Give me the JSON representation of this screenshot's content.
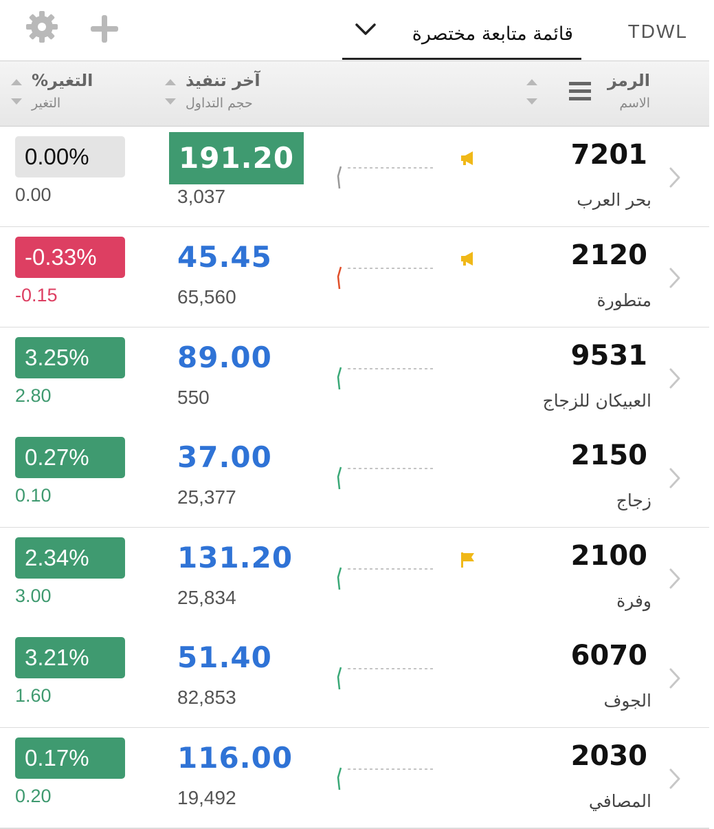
{
  "topbar": {
    "settings_icon": "gear-icon",
    "add_icon": "plus-icon",
    "watchlist_label": "قائمة متابعة مختصرة",
    "market_label": "TDWL"
  },
  "header": {
    "symbol": "الرمز",
    "name": "الاسم",
    "last_trade": "آخر تنفيذ",
    "volume": "حجم التداول",
    "change_pct": "التغير%",
    "change": "التغير"
  },
  "colors": {
    "positive": "#3f9a70",
    "negative": "#dd3f62",
    "neutral": "#e4e4e4",
    "price_blue": "#2f73d6",
    "flag_yellow": "#f0b818"
  },
  "rows": [
    {
      "symbol": "7201",
      "name": "بحر العرب",
      "price": "191.20",
      "volume": "3,037",
      "change_pct": "0.00%",
      "change": "0.00",
      "state": "neutral",
      "highlight": true,
      "flag": "megaphone-icon"
    },
    {
      "symbol": "2120",
      "name": "متطورة",
      "price": "45.45",
      "volume": "65,560",
      "change_pct": "-0.33%",
      "change": "-0.15",
      "state": "negative",
      "highlight": false,
      "flag": "megaphone-icon"
    },
    {
      "symbol": "9531",
      "name": "العبيكان للزجاج",
      "price": "89.00",
      "volume": "550",
      "change_pct": "3.25%",
      "change": "2.80",
      "state": "positive",
      "highlight": false,
      "flag": ""
    },
    {
      "symbol": "2150",
      "name": "زجاج",
      "price": "37.00",
      "volume": "25,377",
      "change_pct": "0.27%",
      "change": "0.10",
      "state": "positive",
      "highlight": false,
      "flag": ""
    },
    {
      "symbol": "2100",
      "name": "وفرة",
      "price": "131.20",
      "volume": "25,834",
      "change_pct": "2.34%",
      "change": "3.00",
      "state": "positive",
      "highlight": false,
      "flag": "flag-icon"
    },
    {
      "symbol": "6070",
      "name": "الجوف",
      "price": "51.40",
      "volume": "82,853",
      "change_pct": "3.21%",
      "change": "1.60",
      "state": "positive",
      "highlight": false,
      "flag": ""
    },
    {
      "symbol": "2030",
      "name": "المصافي",
      "price": "116.00",
      "volume": "19,492",
      "change_pct": "0.17%",
      "change": "0.20",
      "state": "positive",
      "highlight": false,
      "flag": ""
    }
  ]
}
